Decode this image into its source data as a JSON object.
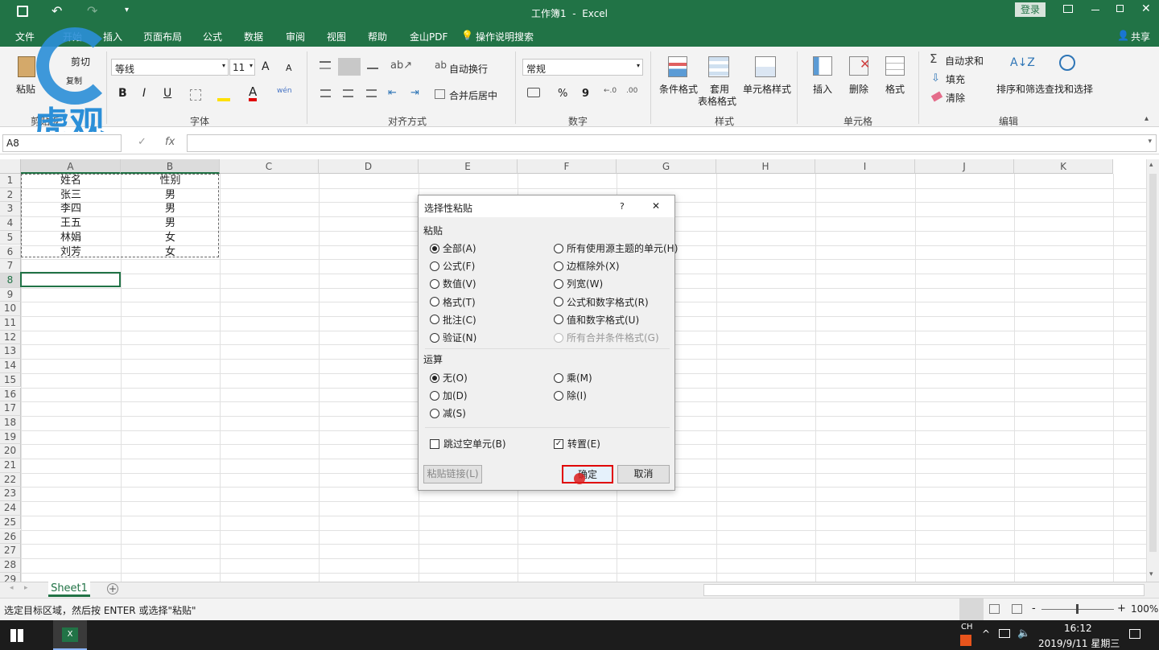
{
  "window": {
    "title": "工作簿1  -  Excel",
    "login_label": "登录"
  },
  "tabs": [
    "文件",
    "开始",
    "插入",
    "页面布局",
    "公式",
    "数据",
    "审阅",
    "视图",
    "帮助",
    "金山PDF"
  ],
  "tell_me": "操作说明搜索",
  "share": "共享",
  "watermark": "虎观",
  "ribbon": {
    "clipboard": {
      "paste": "粘贴",
      "cut": "剪切",
      "copy": "复制",
      "label": "剪贴板"
    },
    "font": {
      "name": "等线",
      "size": "11",
      "label": "字体",
      "bold": "B",
      "italic": "I",
      "underline": "U",
      "grow": "A",
      "shrink": "A",
      "color_letter": "A",
      "phonetic": "wén"
    },
    "alignment": {
      "wrap": "自动换行",
      "merge": "合并后居中",
      "label": "对齐方式"
    },
    "number": {
      "format": "常规",
      "percent": "%",
      "comma": "9",
      "label": "数字"
    },
    "styles": {
      "conditional": "条件格式",
      "table_fmt_1": "套用",
      "table_fmt_2": "表格格式",
      "cell_styles": "单元格样式",
      "label": "样式"
    },
    "cells": {
      "insert": "插入",
      "delete": "删除",
      "format": "格式",
      "label": "单元格"
    },
    "editing": {
      "autosum": "自动求和",
      "fill": "填充",
      "clear": "清除",
      "sort": "排序和筛选",
      "find": "查找和选择",
      "label": "编辑"
    }
  },
  "formula_bar": {
    "name_box": "A8",
    "fx": "fx",
    "formula": ""
  },
  "columns": [
    "A",
    "B",
    "C",
    "D",
    "E",
    "F",
    "G",
    "H",
    "I",
    "J",
    "K"
  ],
  "rows": [
    "1",
    "2",
    "3",
    "4",
    "5",
    "6",
    "7",
    "8",
    "9",
    "10",
    "11",
    "12",
    "13",
    "14",
    "15",
    "16",
    "17",
    "18",
    "19",
    "20",
    "21",
    "22",
    "23",
    "24",
    "25",
    "26",
    "27",
    "28",
    "29"
  ],
  "cells": [
    [
      "姓名",
      "性别"
    ],
    [
      "张三",
      "男"
    ],
    [
      "李四",
      "男"
    ],
    [
      "王五",
      "男"
    ],
    [
      "林娟",
      "女"
    ],
    [
      "刘芳",
      "女"
    ]
  ],
  "sheet_tab": "Sheet1",
  "status": {
    "message": "选定目标区域，然后按 ENTER 或选择\"粘贴\"",
    "zoom": "100%",
    "minus": "-",
    "plus": "+"
  },
  "dialog": {
    "title": "选择性粘贴",
    "help": "?",
    "close": "✕",
    "paste_section": "粘贴",
    "paste_left": [
      "全部(A)",
      "公式(F)",
      "数值(V)",
      "格式(T)",
      "批注(C)",
      "验证(N)"
    ],
    "paste_right": [
      "所有使用源主题的单元(H)",
      "边框除外(X)",
      "列宽(W)",
      "公式和数字格式(R)",
      "值和数字格式(U)",
      "所有合并条件格式(G)"
    ],
    "operation_section": "运算",
    "op_left": [
      "无(O)",
      "加(D)",
      "减(S)"
    ],
    "op_right": [
      "乘(M)",
      "除(I)"
    ],
    "skip_blanks": "跳过空单元(B)",
    "transpose": "转置(E)",
    "paste_link": "粘贴链接(L)",
    "ok": "确定",
    "cancel": "取消"
  },
  "taskbar": {
    "ime": "CH",
    "time": "16:12",
    "date": "2019/9/11 星期三"
  },
  "colors": {
    "excel_green": "#217346",
    "highlight_red": "#e00000"
  }
}
